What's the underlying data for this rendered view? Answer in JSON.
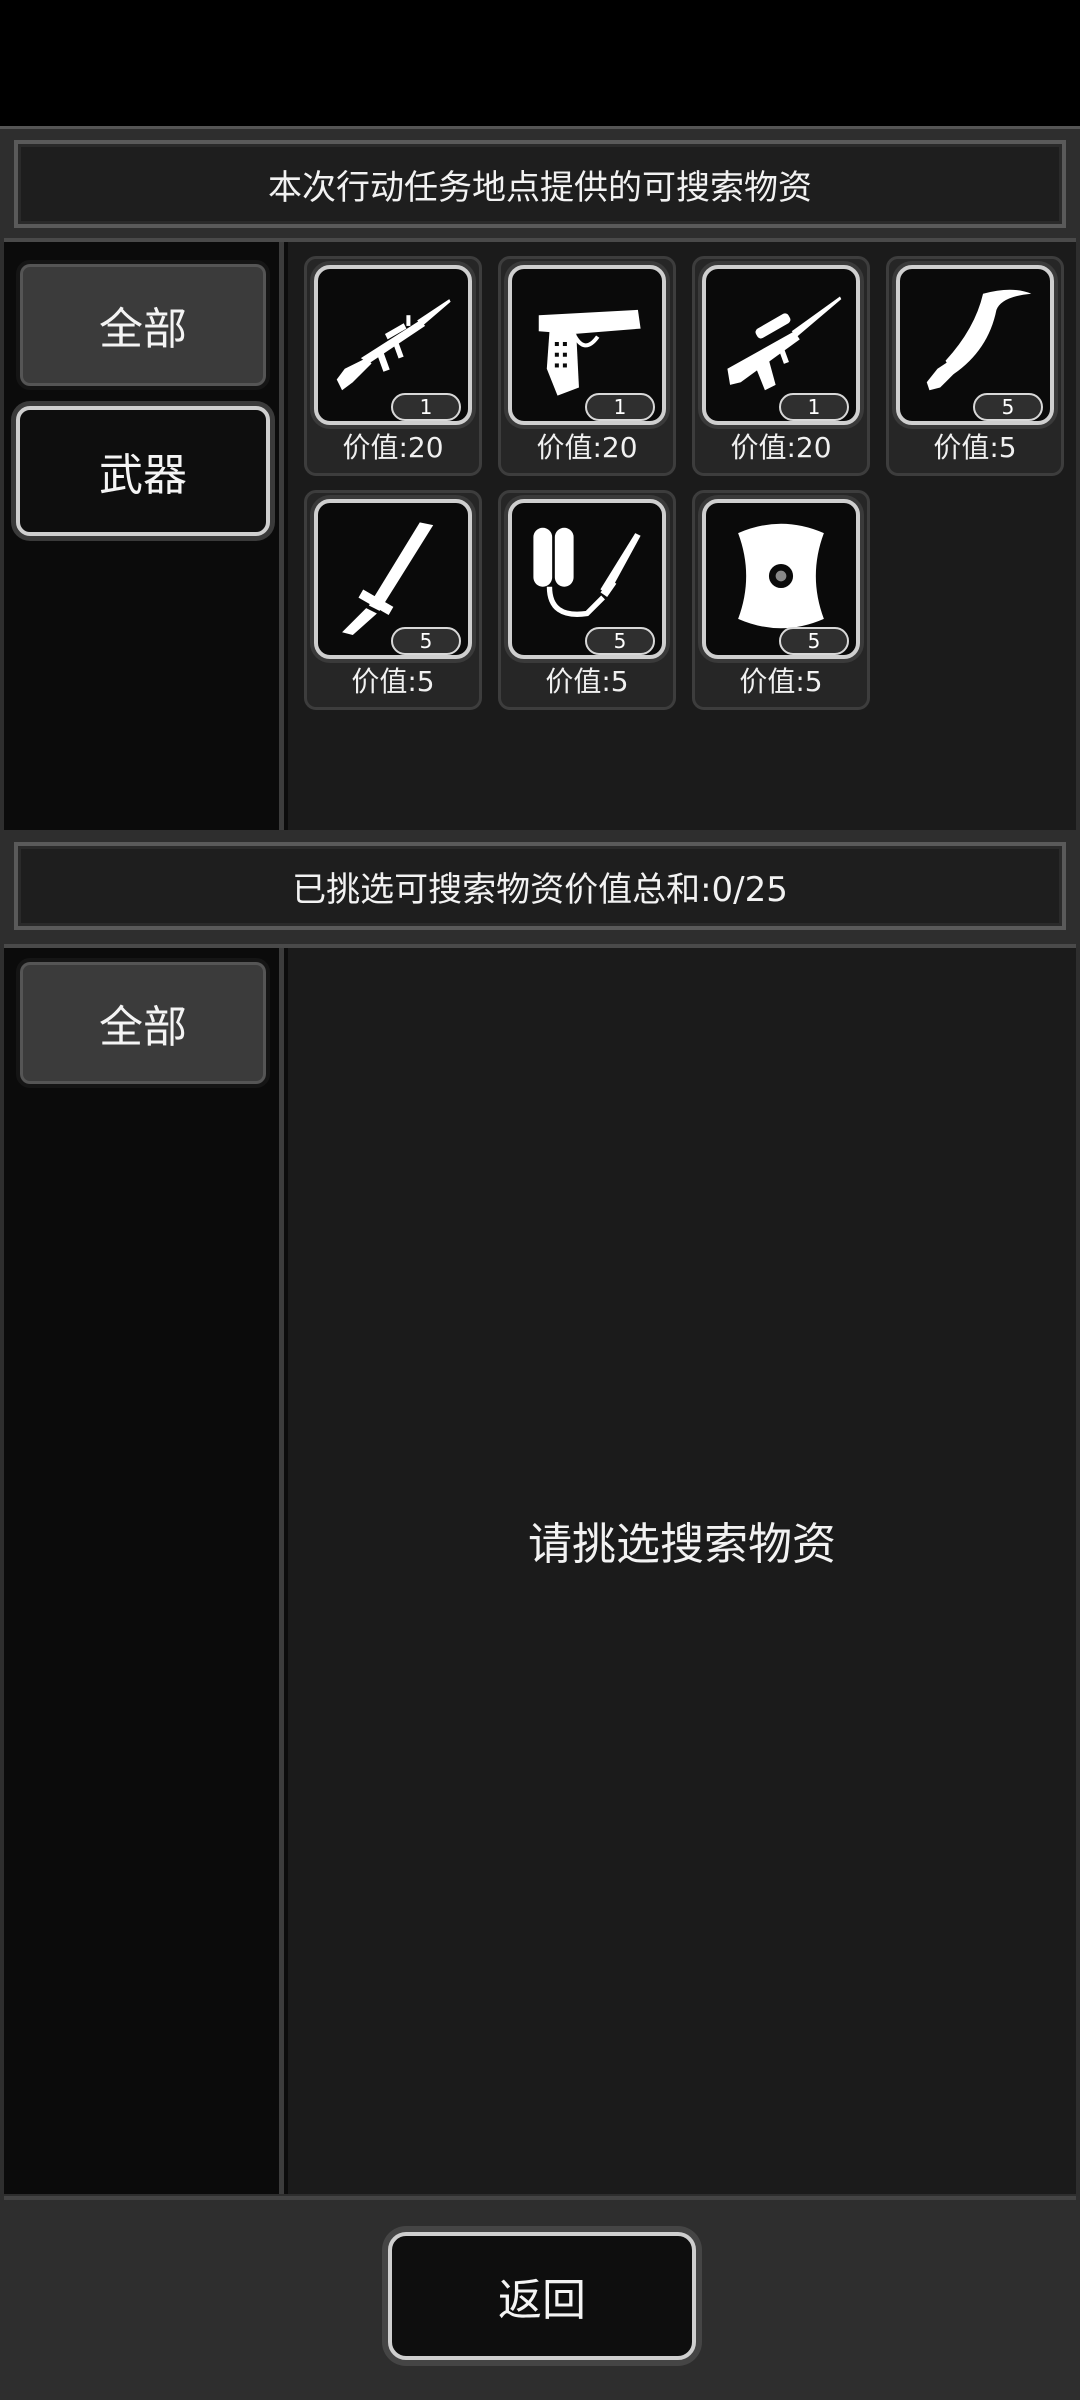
{
  "available_section": {
    "title": "本次行动任务地点提供的可搜索物资",
    "tabs": [
      {
        "label": "全部",
        "active": true
      },
      {
        "label": "武器",
        "active": false
      }
    ],
    "items": [
      {
        "name": "assault-rifle",
        "count": "1",
        "value": "价值:20"
      },
      {
        "name": "pistol",
        "count": "1",
        "value": "价值:20"
      },
      {
        "name": "sniper-rifle",
        "count": "1",
        "value": "价值:20"
      },
      {
        "name": "kukri-knife",
        "count": "5",
        "value": "价值:5"
      },
      {
        "name": "baton",
        "count": "5",
        "value": "价值:5"
      },
      {
        "name": "flamethrower",
        "count": "5",
        "value": "价值:5"
      },
      {
        "name": "shield",
        "count": "5",
        "value": "价值:5"
      }
    ]
  },
  "selected_section": {
    "title": "已挑选可搜索物资价值总和:0/25",
    "tabs": [
      {
        "label": "全部",
        "active": true
      }
    ],
    "empty_hint": "请挑选搜索物资"
  },
  "footer": {
    "back_label": "返回"
  }
}
